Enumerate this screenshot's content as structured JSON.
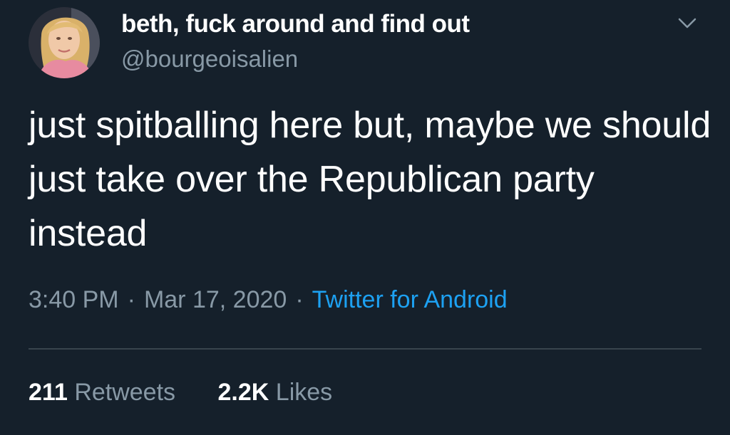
{
  "author": {
    "display_name": "beth, fuck around and find out",
    "handle": "@bourgeoisalien",
    "avatar_icon": "user-avatar-photo"
  },
  "tweet": {
    "text": "just spitballing here but, maybe we should just take over the Republican party instead",
    "time": "3:40 PM",
    "date": "Mar 17, 2020",
    "separator": "·",
    "source": "Twitter for Android"
  },
  "stats": {
    "retweets_count": "211",
    "retweets_label": "Retweets",
    "likes_count": "2.2K",
    "likes_label": "Likes"
  },
  "icons": {
    "menu": "chevron-down-icon"
  },
  "colors": {
    "background": "#15202b",
    "primary_text": "#ffffff",
    "secondary_text": "#8899a6",
    "link": "#1da1f2",
    "divider": "#38444d"
  }
}
